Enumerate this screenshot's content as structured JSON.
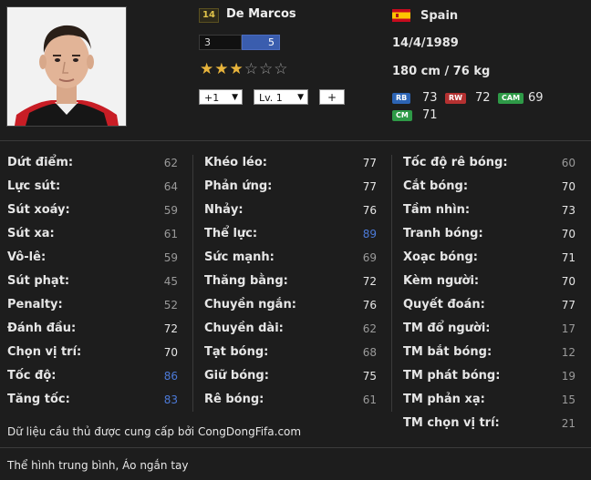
{
  "player": {
    "jersey_number": "14",
    "name": "De Marcos",
    "weak_foot": "3",
    "skill_moves": "5",
    "stars_filled": 3,
    "stars_total": 6,
    "upgrade_select": "+1",
    "level_select": "Lv. 1",
    "add_button": "+",
    "nation": "Spain",
    "dob": "14/4/1989",
    "height_weight": "180 cm / 76 kg"
  },
  "positions": [
    {
      "code": "RB",
      "rating": "73",
      "color": "#2c64b4"
    },
    {
      "code": "RW",
      "rating": "72",
      "color": "#b53131"
    },
    {
      "code": "CAM",
      "rating": "69",
      "color": "#2e9a47"
    },
    {
      "code": "CM",
      "rating": "71",
      "color": "#2e9a47"
    }
  ],
  "colors": {
    "stat_normal": "#9a9a9a",
    "stat_high": "#e6e6e6",
    "stat_boost": "#4c7ad8"
  },
  "stats": {
    "col1": [
      {
        "label": "Dứt điểm:",
        "value": "62",
        "tone": "normal"
      },
      {
        "label": "Lực sút:",
        "value": "64",
        "tone": "normal"
      },
      {
        "label": "Sút xoáy:",
        "value": "59",
        "tone": "normal"
      },
      {
        "label": "Sút xa:",
        "value": "61",
        "tone": "normal"
      },
      {
        "label": "Vô-lê:",
        "value": "59",
        "tone": "normal"
      },
      {
        "label": "Sút phạt:",
        "value": "45",
        "tone": "normal"
      },
      {
        "label": "Penalty:",
        "value": "52",
        "tone": "normal"
      },
      {
        "label": "Đánh đầu:",
        "value": "72",
        "tone": "high"
      },
      {
        "label": "Chọn vị trí:",
        "value": "70",
        "tone": "high"
      },
      {
        "label": "Tốc độ:",
        "value": "86",
        "tone": "boost"
      },
      {
        "label": "Tăng tốc:",
        "value": "83",
        "tone": "boost"
      }
    ],
    "col2": [
      {
        "label": "Khéo léo:",
        "value": "77",
        "tone": "high"
      },
      {
        "label": "Phản ứng:",
        "value": "77",
        "tone": "high"
      },
      {
        "label": "Nhảy:",
        "value": "76",
        "tone": "high"
      },
      {
        "label": "Thể lực:",
        "value": "89",
        "tone": "boost"
      },
      {
        "label": "Sức mạnh:",
        "value": "69",
        "tone": "normal"
      },
      {
        "label": "Thăng bằng:",
        "value": "72",
        "tone": "high"
      },
      {
        "label": "Chuyền ngắn:",
        "value": "76",
        "tone": "high"
      },
      {
        "label": "Chuyền dài:",
        "value": "62",
        "tone": "normal"
      },
      {
        "label": "Tạt bóng:",
        "value": "68",
        "tone": "normal"
      },
      {
        "label": "Giữ bóng:",
        "value": "75",
        "tone": "high"
      },
      {
        "label": "Rê bóng:",
        "value": "61",
        "tone": "normal"
      }
    ],
    "col3": [
      {
        "label": "Tốc độ rê bóng:",
        "value": "60",
        "tone": "normal"
      },
      {
        "label": "Cắt bóng:",
        "value": "70",
        "tone": "high"
      },
      {
        "label": "Tầm nhìn:",
        "value": "73",
        "tone": "high"
      },
      {
        "label": "Tranh bóng:",
        "value": "70",
        "tone": "high"
      },
      {
        "label": "Xoạc bóng:",
        "value": "71",
        "tone": "high"
      },
      {
        "label": "Kèm người:",
        "value": "70",
        "tone": "high"
      },
      {
        "label": "Quyết đoán:",
        "value": "77",
        "tone": "high"
      },
      {
        "label": "TM đổ người:",
        "value": "17",
        "tone": "normal"
      },
      {
        "label": "TM bắt bóng:",
        "value": "12",
        "tone": "normal"
      },
      {
        "label": "TM phát bóng:",
        "value": "19",
        "tone": "normal"
      },
      {
        "label": "TM phản xạ:",
        "value": "15",
        "tone": "normal"
      },
      {
        "label": "TM chọn vị trí:",
        "value": "21",
        "tone": "normal"
      }
    ]
  },
  "footer": {
    "source": "Dữ liệu cầu thủ được cung cấp bởi CongDongFifa.com",
    "description": "Thể hình trung bình, Áo ngắn tay"
  }
}
